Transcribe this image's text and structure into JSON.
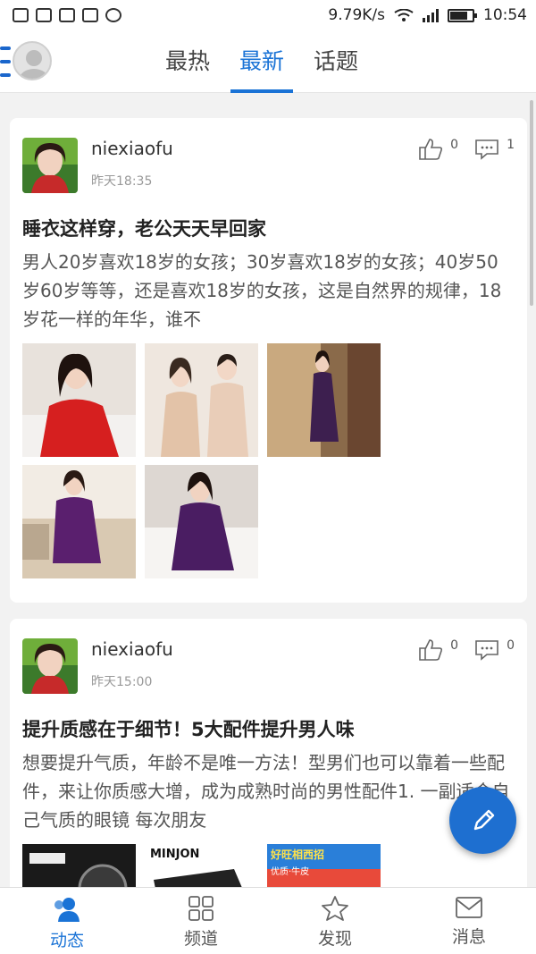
{
  "status_bar": {
    "speed": "9.79K/s",
    "time": "10:54"
  },
  "header": {
    "tabs": [
      {
        "label": "最热"
      },
      {
        "label": "最新"
      },
      {
        "label": "话题"
      }
    ],
    "active_tab": "最新"
  },
  "posts": [
    {
      "username": "niexiaofu",
      "time": "昨天18:35",
      "likes": "0",
      "comments": "1",
      "title": "睡衣这样穿，老公天天早回家",
      "excerpt": "男人20岁喜欢18岁的女孩；30岁喜欢18岁的女孩；40岁50岁60岁等等，还是喜欢18岁的女孩，这是自然界的规律，18岁花一样的年华，谁不"
    },
    {
      "username": "niexiaofu",
      "time": "昨天15:00",
      "likes": "0",
      "comments": "0",
      "title": "提升质感在于细节！5大配件提升男人味",
      "excerpt": "想要提升气质，年龄不是唯一方法！型男们也可以靠着一些配件，来让你质感大增，成为成熟时尚的男性配件1. 一副适合自己气质的眼镜 每次朋友",
      "thumb_texts": [
        "MINJON",
        "好旺相西招",
        "优质·牛皮"
      ]
    }
  ],
  "bottom_nav": [
    {
      "label": "动态"
    },
    {
      "label": "频道"
    },
    {
      "label": "发现"
    },
    {
      "label": "消息"
    }
  ],
  "colors": {
    "accent": "#1a73d6",
    "fab": "#1e6fd0"
  }
}
